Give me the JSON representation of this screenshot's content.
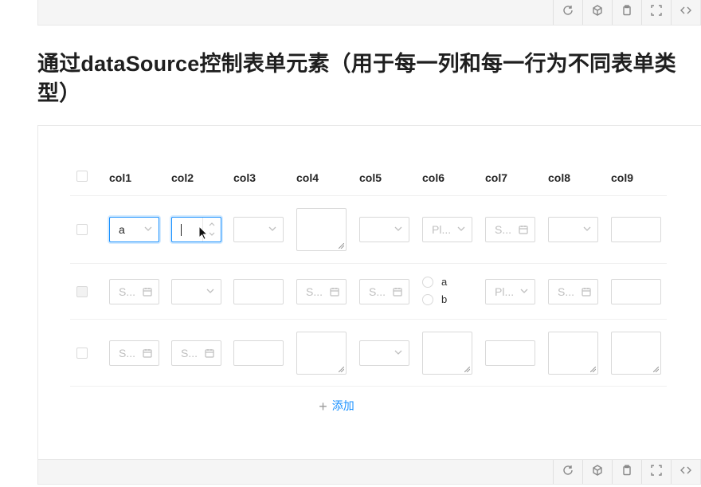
{
  "toolbar": {
    "icons": [
      "refresh-icon",
      "cube-icon",
      "clipboard-icon",
      "fullscreen-icon",
      "code-icon"
    ]
  },
  "title": "通过dataSource控制表单元素（用于每一列和每一行为不同表单类型）",
  "table": {
    "columns": [
      "col1",
      "col2",
      "col3",
      "col4",
      "col5",
      "col6",
      "col7",
      "col8",
      "col9"
    ],
    "rows": [
      {
        "checkbox_disabled": false,
        "col1": {
          "type": "select",
          "value": "a",
          "active": true
        },
        "col2": {
          "type": "number",
          "value": "",
          "active": true
        },
        "col3": {
          "type": "select",
          "value": ""
        },
        "col4": {
          "type": "textarea"
        },
        "col5": {
          "type": "select",
          "value": ""
        },
        "col6": {
          "type": "select",
          "placeholder": "Pl..."
        },
        "col7": {
          "type": "date",
          "placeholder": "S..."
        },
        "col8": {
          "type": "select",
          "value": ""
        },
        "col9": {
          "type": "input"
        }
      },
      {
        "checkbox_disabled": true,
        "col1": {
          "type": "date",
          "placeholder": "S..."
        },
        "col2": {
          "type": "select",
          "value": ""
        },
        "col3": {
          "type": "input"
        },
        "col4": {
          "type": "date",
          "placeholder": "S..."
        },
        "col5": {
          "type": "date",
          "placeholder": "S..."
        },
        "col6": {
          "type": "radio",
          "options": [
            "a",
            "b"
          ]
        },
        "col7": {
          "type": "select",
          "placeholder": "Pl..."
        },
        "col8": {
          "type": "date",
          "placeholder": "S..."
        },
        "col9": {
          "type": "input"
        }
      },
      {
        "checkbox_disabled": false,
        "col1": {
          "type": "date",
          "placeholder": "S..."
        },
        "col2": {
          "type": "date",
          "placeholder": "S..."
        },
        "col3": {
          "type": "input"
        },
        "col4": {
          "type": "textarea"
        },
        "col5": {
          "type": "select",
          "value": ""
        },
        "col6": {
          "type": "textarea"
        },
        "col7": {
          "type": "input"
        },
        "col8": {
          "type": "textarea"
        },
        "col9": {
          "type": "textarea"
        }
      }
    ],
    "add_label": "添加"
  },
  "colors": {
    "accent": "#1890ff",
    "border": "#d9d9d9",
    "placeholder": "#bfbfbf"
  }
}
